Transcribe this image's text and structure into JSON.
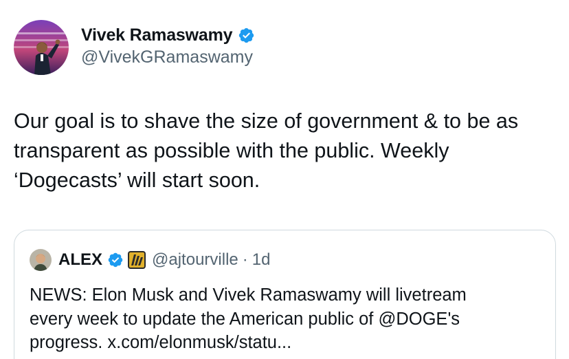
{
  "author": {
    "display_name": "Vivek Ramaswamy",
    "handle": "@VivekGRamaswamy",
    "verified_badge": "verified-badge-icon"
  },
  "tweet": {
    "text": "Our goal is to shave the size of government & to be as\ntransparent as possible with the public. Weekly\n‘Dogecasts’ will start soon."
  },
  "quoted_tweet": {
    "display_name": "ALEX",
    "handle": "@ajtourville",
    "separator": "·",
    "time": "1d",
    "affiliate_badge": "affiliate-badge-icon",
    "text": "NEWS: Elon Musk and Vivek Ramaswamy will livetream\nevery week to update the American public of @DOGE's\nprogress. x.com/elonmusk/statu..."
  },
  "colors": {
    "text_primary": "#0f1419",
    "text_secondary": "#536471",
    "verified_blue": "#1d9bf0",
    "border": "#cfd9de"
  }
}
